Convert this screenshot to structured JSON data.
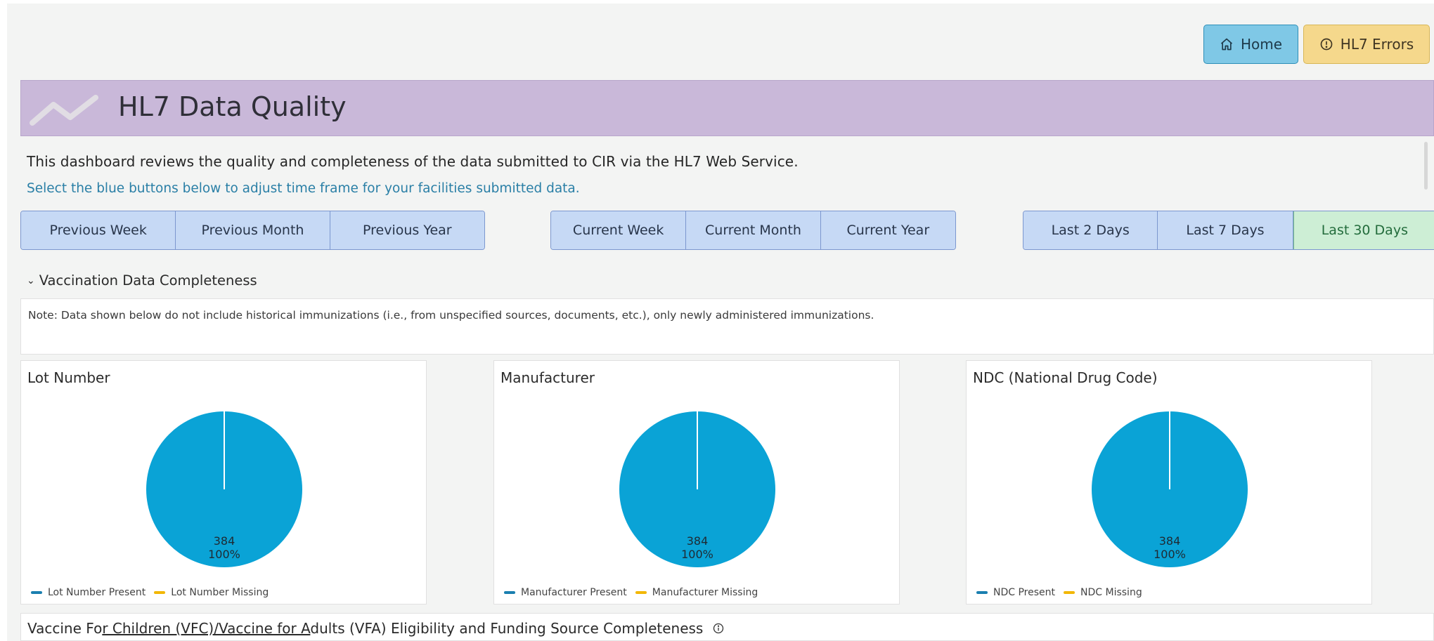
{
  "header": {
    "home_label": "Home",
    "errors_label": "HL7 Errors",
    "title": "HL7 Data Quality",
    "description": "This dashboard reviews the quality and completeness of the data submitted to CIR via the HL7 Web Service.",
    "instruction": "Select the blue buttons below to adjust time frame for your facilities submitted data."
  },
  "filters": {
    "previous": [
      "Previous Week",
      "Previous Month",
      "Previous Year"
    ],
    "current": [
      "Current Week",
      "Current Month",
      "Current Year"
    ],
    "last": [
      "Last 2 Days",
      "Last 7 Days",
      "Last 30 Days"
    ],
    "active": "Last 30 Days"
  },
  "section": {
    "title": "Vaccination Data Completeness",
    "note": "Note: Data shown below do not include historical immunizations (i.e., from unspecified sources, documents, etc.), only newly administered immunizations."
  },
  "colors": {
    "present": "#0aa3d6",
    "missing": "#f2b705",
    "present_legend": "#1a7fb0"
  },
  "chart_data": [
    {
      "type": "pie",
      "title": "Lot Number",
      "labels": [
        "Lot Number Present",
        "Lot Number Missing"
      ],
      "values": [
        384,
        0
      ],
      "data_label_value": "384",
      "data_label_percent": "100%"
    },
    {
      "type": "pie",
      "title": "Manufacturer",
      "labels": [
        "Manufacturer Present",
        "Manufacturer Missing"
      ],
      "values": [
        384,
        0
      ],
      "data_label_value": "384",
      "data_label_percent": "100%"
    },
    {
      "type": "pie",
      "title": "NDC (National Drug Code)",
      "labels": [
        "NDC Present",
        "NDC Missing"
      ],
      "values": [
        384,
        0
      ],
      "data_label_value": "384",
      "data_label_percent": "100%"
    }
  ],
  "bottom": {
    "title_parts": [
      "Vaccine Fo",
      "r Children (VFC)/Vaccine for A",
      "dults (VFA) Eligibility and Funding Source Completeness"
    ]
  },
  "icons": {
    "home": "home-icon",
    "errors": "alert-circle-icon",
    "logo": "trend-line-icon",
    "info": "info-icon"
  }
}
